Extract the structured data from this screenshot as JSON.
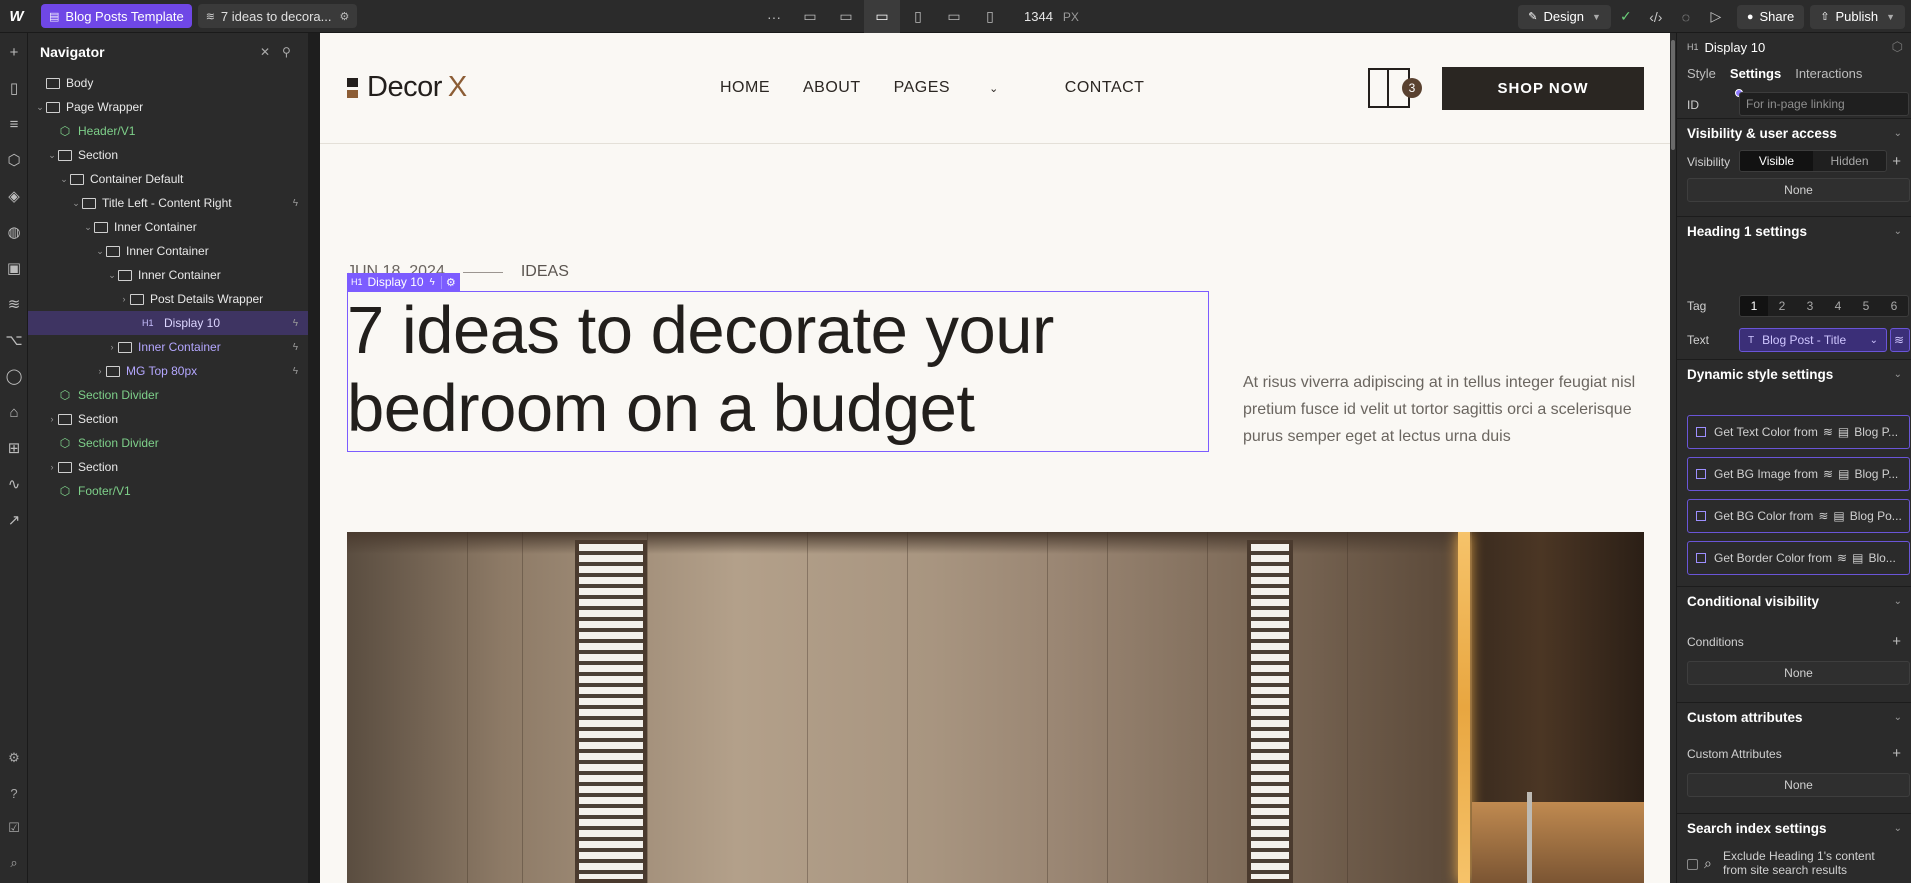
{
  "topbar": {
    "logo": "W",
    "page_pill": "Blog Posts Template",
    "cms_pill": "7 ideas to decora...",
    "more": "···",
    "width_value": "1344",
    "width_unit": "PX",
    "design_label": "Design",
    "share_label": "Share",
    "publish_label": "Publish"
  },
  "navigator": {
    "title": "Navigator",
    "items": [
      {
        "label": "Body"
      },
      {
        "label": "Page Wrapper"
      },
      {
        "label": "Header/V1"
      },
      {
        "label": "Section"
      },
      {
        "label": "Container Default"
      },
      {
        "label": "Title Left - Content Right"
      },
      {
        "label": "Inner Container"
      },
      {
        "label": "Inner Container"
      },
      {
        "label": "Inner Container"
      },
      {
        "label": "Post Details Wrapper"
      },
      {
        "label": "Display 10",
        "tag": "H1"
      },
      {
        "label": "Inner Container"
      },
      {
        "label": "MG Top 80px"
      },
      {
        "label": "Section Divider"
      },
      {
        "label": "Section"
      },
      {
        "label": "Section Divider"
      },
      {
        "label": "Section"
      },
      {
        "label": "Footer/V1"
      }
    ]
  },
  "site": {
    "logo_text": "Decor",
    "logo_x": "X",
    "menu": [
      "HOME",
      "ABOUT",
      "PAGES",
      "CONTACT"
    ],
    "cart_count": "3",
    "shop_button": "SHOP NOW",
    "date": "JUN 18, 2024",
    "category": "IDEAS",
    "selection_tag": "H1",
    "selection_label": "Display 10",
    "headline": "7 ideas to decorate your bedroom on a budget",
    "intro": "At risus viverra adipiscing at in tellus integer feugiat nisl pretium fusce id velit ut tortor sagittis orci a scelerisque purus semper eget at lectus urna duis"
  },
  "right_panel": {
    "element_tag": "H1",
    "element_name": "Display 10",
    "tabs": [
      "Style",
      "Settings",
      "Interactions"
    ],
    "active_tab": "Settings",
    "id_label": "ID",
    "id_placeholder": "For in-page linking",
    "visibility_section": "Visibility & user access",
    "visibility_label": "Visibility",
    "visible": "Visible",
    "hidden": "Hidden",
    "none": "None",
    "heading_section": "Heading 1 settings",
    "tag_label": "Tag",
    "tags": [
      "1",
      "2",
      "3",
      "4",
      "5",
      "6"
    ],
    "text_label": "Text",
    "text_binding": "Blog Post - Title",
    "dynamic_section": "Dynamic style settings",
    "dynamic_rows": [
      {
        "label": "Get Text Color from",
        "source": "Blog P..."
      },
      {
        "label": "Get BG Image from",
        "source": "Blog P..."
      },
      {
        "label": "Get BG Color from",
        "source": "Blog Po..."
      },
      {
        "label": "Get Border Color from",
        "source": "Blo..."
      }
    ],
    "conditional_section": "Conditional visibility",
    "conditions_label": "Conditions",
    "custom_attr_section": "Custom attributes",
    "custom_attr_label": "Custom Attributes",
    "search_section": "Search index settings",
    "search_exclude_line1": "Exclude Heading 1's content",
    "search_exclude_line2": "from site search results"
  }
}
